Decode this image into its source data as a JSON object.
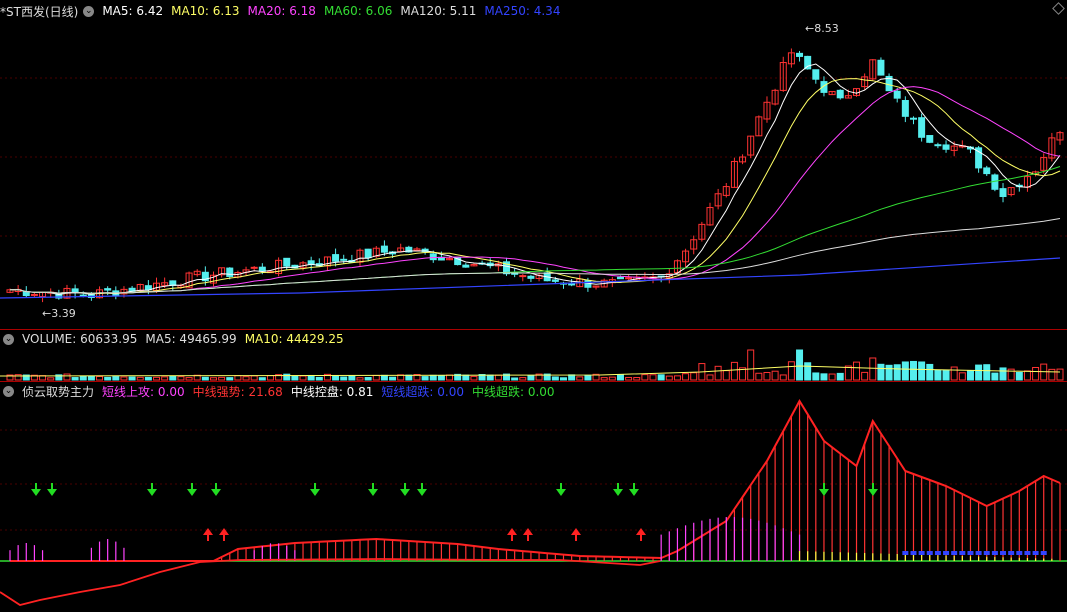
{
  "header": {
    "title": "*ST西发(日线)",
    "ma": [
      {
        "label": "MA5: 6.42",
        "color": "#ffffff"
      },
      {
        "label": "MA10: 6.13",
        "color": "#ffff66"
      },
      {
        "label": "MA20: 6.18",
        "color": "#ff44ff"
      },
      {
        "label": "MA60: 6.06",
        "color": "#33dd33"
      },
      {
        "label": "MA120: 5.11",
        "color": "#dddddd"
      },
      {
        "label": "MA250: 4.34",
        "color": "#3344ff"
      }
    ]
  },
  "volume_header": {
    "items": [
      {
        "label": "VOLUME: 60633.95",
        "color": "#dddddd"
      },
      {
        "label": "MA5: 49465.99",
        "color": "#dddddd"
      },
      {
        "label": "MA10: 44429.25",
        "color": "#ffff66"
      }
    ]
  },
  "indicator_header": {
    "title": "侦云取势主力",
    "items": [
      {
        "label": "短线上攻: 0.00",
        "color": "#ff44ff"
      },
      {
        "label": "中线强势: 21.68",
        "color": "#ff3333"
      },
      {
        "label": "中线控盘: 0.81",
        "color": "#ffffff"
      },
      {
        "label": "短线超跌: 0.00",
        "color": "#3344ff"
      },
      {
        "label": "中线超跌: 0.00",
        "color": "#33dd33"
      }
    ]
  },
  "chart_data": {
    "type": "candlestick",
    "annotations": {
      "high": "8.53",
      "low": "3.39"
    },
    "colors": {
      "up": "#ff3333",
      "down": "#55eeee"
    }
  }
}
